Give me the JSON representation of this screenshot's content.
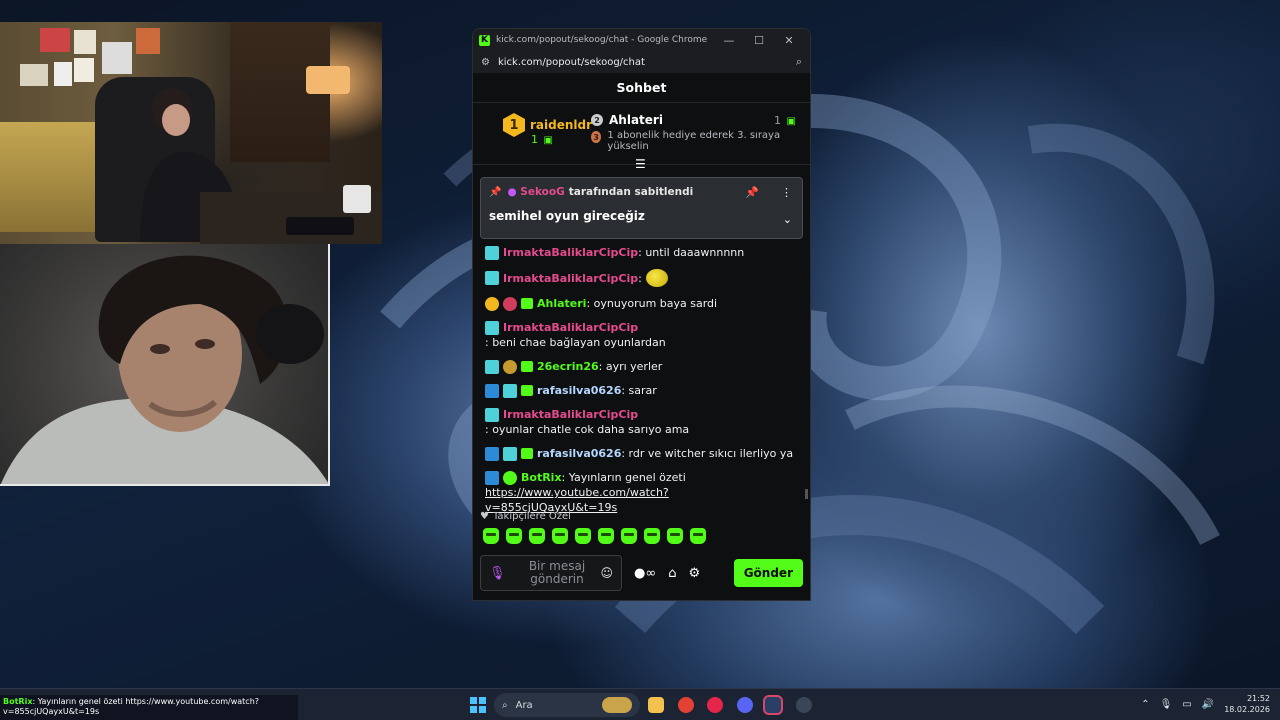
{
  "window": {
    "title": "kick.com/popout/sekoog/chat - Google Chrome",
    "url": "kick.com/popout/sekoog/chat",
    "favicon_letter": "K"
  },
  "chat": {
    "header": "Sohbet",
    "leaderboard": {
      "first": {
        "rank": "1",
        "name": "raidenldr",
        "count": "1"
      },
      "second": {
        "rank": "2",
        "name": "Ahlateri",
        "count": "1"
      },
      "third": {
        "rank": "3",
        "hint": "1 abonelik hediye ederek 3. sıraya yükselin"
      }
    },
    "pinned": {
      "owner": "SekooG",
      "by_text": "tarafından sabitlendi",
      "message": "semihel oyun gireceğiz"
    },
    "messages": [
      {
        "user": "IrmaktaBaliklarCipCip",
        "color": "pink",
        "badges": [
          "sub"
        ],
        "text": ": until daaawnnnnn"
      },
      {
        "user": "IrmaktaBaliklarCipCip",
        "color": "pink",
        "badges": [
          "sub"
        ],
        "text": ":",
        "emote": true
      },
      {
        "user": "Ahlateri",
        "color": "green",
        "badges": [
          "rank",
          "og",
          "gift"
        ],
        "text": ": oynuyorum baya sardi"
      },
      {
        "user": "IrmaktaBaliklarCipCip",
        "color": "pink",
        "badges": [
          "sub"
        ],
        "text": ": beni chae bağlayan oyunlardan"
      },
      {
        "user": "26ecrin26",
        "color": "green",
        "badges": [
          "sub",
          "med",
          "gift"
        ],
        "text": ": ayrı yerler"
      },
      {
        "user": "rafasilva0626",
        "color": "lblue",
        "badges": [
          "vip",
          "sub",
          "gift"
        ],
        "text": ": sarar"
      },
      {
        "user": "IrmaktaBaliklarCipCip",
        "color": "pink",
        "badges": [
          "sub"
        ],
        "text": ": oyunlar chatle cok daha sarıyo ama"
      },
      {
        "user": "rafasilva0626",
        "color": "lblue",
        "badges": [
          "vip",
          "sub",
          "gift"
        ],
        "text": ": rdr ve witcher sıkıcı ilerliyo ya"
      },
      {
        "user": "BotRix",
        "color": "bot",
        "badges": [
          "vip",
          "verif"
        ],
        "text": ": Yayınların genel özeti",
        "link": "https://www.youtube.com/watch?v=855cjUQayxU&t=19s"
      }
    ],
    "emotes_title": "Takipçilere Özel",
    "emote_count": 10,
    "input": {
      "placeholder": "Bir mesaj gönderin",
      "send_label": "Gönder"
    }
  },
  "taskbar": {
    "ticker_user": "BotRix",
    "ticker_text": ": Yayınların genel özeti https://www.youtube.com/watch?v=855cjUQayxU&t=19s",
    "search_placeholder": "Ara",
    "time": "21:52",
    "date": "18.02.2026"
  },
  "colors": {
    "kick_green": "#53fc18",
    "pink_user": "#e54b8e",
    "gold": "#f4b81f"
  }
}
